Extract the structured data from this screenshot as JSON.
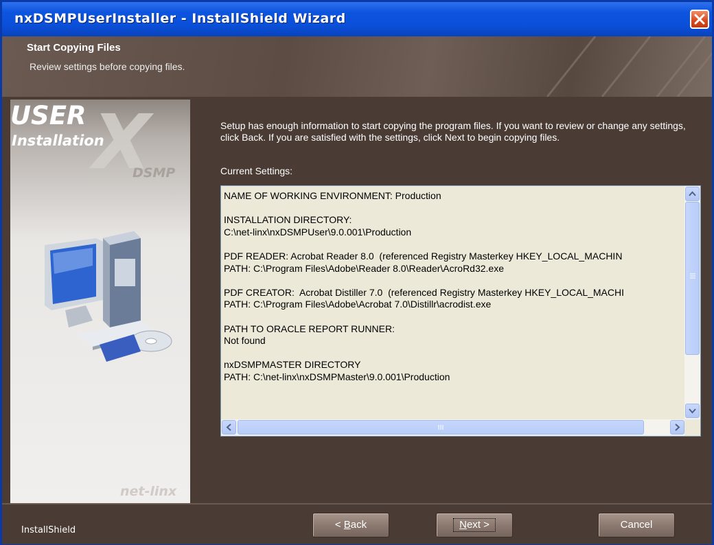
{
  "window": {
    "title": "nxDSMPUserInstaller - InstallShield Wizard",
    "close_icon": "close-icon"
  },
  "header": {
    "title": "Start Copying Files",
    "subtitle": "Review settings before copying files."
  },
  "sidebar": {
    "line1": "USER",
    "line2": "Installation",
    "logo_text": "DSMP",
    "bg_letter": "X",
    "brand": "net-linx",
    "image": "computer-with-cd-icon"
  },
  "main": {
    "intro": "Setup has enough information to start copying the program files.  If you want to review or change any settings, click Back.  If you are satisfied with the settings, click Next to begin copying files.",
    "current_settings_label": "Current Settings:",
    "settings_lines": [
      "NAME OF WORKING ENVIRONMENT: Production",
      "",
      "INSTALLATION DIRECTORY:",
      "C:\\net-linx\\nxDSMPUser\\9.0.001\\Production",
      "",
      "PDF READER: Acrobat Reader 8.0  (referenced Registry Masterkey HKEY_LOCAL_MACHIN",
      "PATH: C:\\Program Files\\Adobe\\Reader 8.0\\Reader\\AcroRd32.exe",
      "",
      "PDF CREATOR:  Acrobat Distiller 7.0  (referenced Registry Masterkey HKEY_LOCAL_MACHI",
      "PATH: C:\\Program Files\\Adobe\\Acrobat 7.0\\Distillr\\acrodist.exe",
      "",
      "PATH TO ORACLE REPORT RUNNER:",
      "Not found",
      "",
      "nxDSMPMASTER DIRECTORY",
      "PATH: C:\\net-linx\\nxDSMPMaster\\9.0.001\\Production"
    ]
  },
  "footer": {
    "brand": "InstallShield",
    "back_label_pre": "< ",
    "back_label_key": "B",
    "back_label_post": "ack",
    "next_label_key": "N",
    "next_label_post": "ext >",
    "cancel_label": "Cancel"
  }
}
